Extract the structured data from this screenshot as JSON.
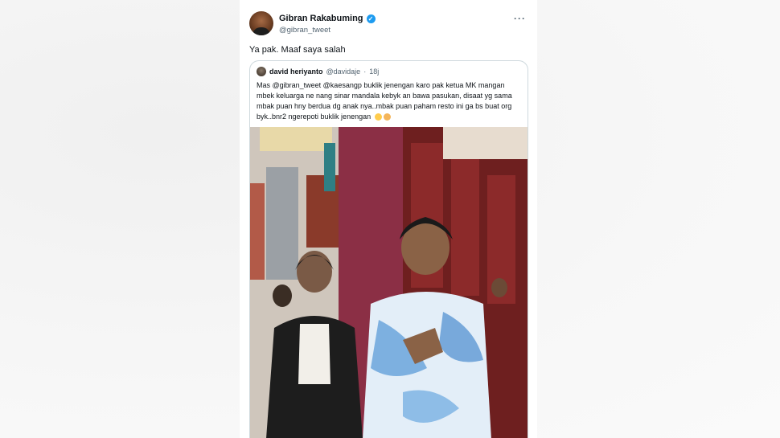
{
  "tweet": {
    "display_name": "Gibran Rakabuming",
    "handle": "@gibran_tweet",
    "more_icon": "more-horizontal-icon",
    "text": "Ya pak. Maaf saya salah"
  },
  "quoted_tweet": {
    "display_name": "david heriyanto",
    "handle": "@davidaje",
    "separator": "·",
    "time": "18j",
    "text": "Mas @gibran_tweet @kaesangp buklik jenengan karo pak ketua MK mangan mbek keluarga ne nang sinar mandala kebyk an bawa pasukan, disaat yg sama mbak puan hny berdua dg anak nya..mbak puan paham resto ini ga bs buat org byk..bnr2 ngerepoti buklik jenengan",
    "emojis": [
      "grinning-sweat-emoji",
      "hand-emoji"
    ],
    "photo_alt": "photo-two-people-restaurant"
  },
  "colors": {
    "verified": "#1d9bf0",
    "text_primary": "#0f1419",
    "text_secondary": "#536471",
    "border": "#cfd9de"
  }
}
